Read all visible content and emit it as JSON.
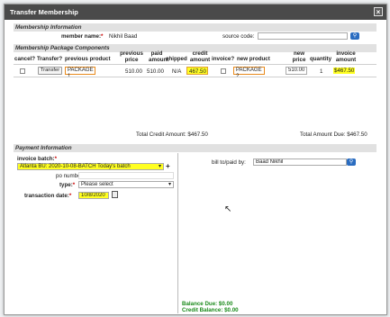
{
  "dialog": {
    "title": "Transfer Membership",
    "close": "×"
  },
  "member_info": {
    "section": "Membership Information",
    "member_name_label": "member name:",
    "member_name_value": "Nikhil Baad",
    "source_code_label": "source code:",
    "source_code_value": ""
  },
  "components": {
    "section": "Membership Package Components",
    "headers": {
      "cancel": "cancel?",
      "transfer": "Transfer?",
      "previous_product": "previous product",
      "previous_price": [
        "previous",
        "price"
      ],
      "paid_amount": [
        "paid",
        "amount"
      ],
      "shipped": "shipped",
      "credit_amount": [
        "credit",
        "amount"
      ],
      "invoice": "invoice?",
      "new_product": "new product",
      "new_price": [
        "new",
        "price"
      ],
      "quantity": "quantity",
      "invoice_amount": [
        "invoice",
        "amount"
      ]
    },
    "row": {
      "transfer_button": "Transfer",
      "previous_product": "PACKAGE 1",
      "previous_price": "510.00",
      "paid_amount": "510.00",
      "shipped": "N/A",
      "credit_amount": "467.50",
      "new_product": "PACKAGE 2",
      "new_price": "510.00",
      "quantity": "1",
      "invoice_amount": "$467.50"
    },
    "total_credit": "Total Credit Amount: $467.50",
    "total_due": "Total Amount Due: $467.50"
  },
  "payment": {
    "section": "Payment Information",
    "invoice_batch_label": "invoice batch:",
    "invoice_batch_value": "Atlanta BU: 2020-10-08-BATCH Today's batch",
    "po_number_label": "po number:",
    "po_number_value": "",
    "type_label": "type:",
    "type_value": "Please select",
    "transaction_date_label": "transaction date:",
    "transaction_date_value": "10/8/2020",
    "bill_to_label": "bill to/paid by:",
    "bill_to_value": "Baad Nikhil",
    "balance_due": "Balance Due: $0.00",
    "credit_balance": "Credit Balance: $0.00"
  },
  "colors": {
    "highlight": "#ffff22",
    "balance": "#1a8a1a",
    "search_button": "#2a6cc0",
    "package_border": "#e88a1c"
  }
}
